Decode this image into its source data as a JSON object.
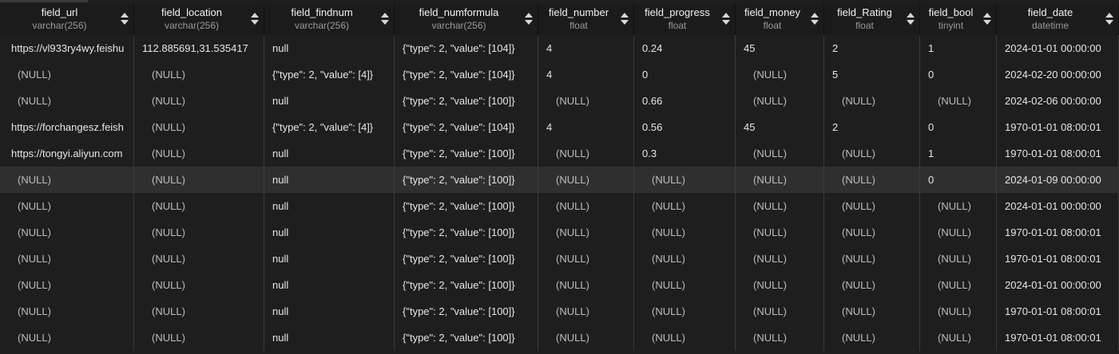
{
  "columns": [
    {
      "name": "field_url",
      "type": "varchar(256)",
      "w": 168
    },
    {
      "name": "field_location",
      "type": "varchar(256)",
      "w": 163
    },
    {
      "name": "field_findnum",
      "type": "varchar(256)",
      "w": 163
    },
    {
      "name": "field_numformula",
      "type": "varchar(256)",
      "w": 180
    },
    {
      "name": "field_number",
      "type": "float",
      "w": 120
    },
    {
      "name": "field_progress",
      "type": "float",
      "w": 127
    },
    {
      "name": "field_money",
      "type": "float",
      "w": 111
    },
    {
      "name": "field_Rating",
      "type": "float",
      "w": 120
    },
    {
      "name": "field_bool",
      "type": "tinyint",
      "w": 96
    },
    {
      "name": "field_date",
      "type": "datetime",
      "w": 153
    }
  ],
  "selected_row": 5,
  "rows": [
    [
      "https://vl933ry4wy.feishu",
      "112.885691,31.535417",
      "null",
      "{\"type\": 2, \"value\": [104]}",
      "4",
      "0.24",
      "45",
      "2",
      "1",
      "2024-01-01 00:00:00"
    ],
    [
      "(NULL)",
      "(NULL)",
      "{\"type\": 2, \"value\": [4]}",
      "{\"type\": 2, \"value\": [104]}",
      "4",
      "0",
      "(NULL)",
      "5",
      "0",
      "2024-02-20 00:00:00"
    ],
    [
      "(NULL)",
      "(NULL)",
      "null",
      "{\"type\": 2, \"value\": [100]}",
      "(NULL)",
      "0.66",
      "(NULL)",
      "(NULL)",
      "(NULL)",
      "2024-02-06 00:00:00"
    ],
    [
      "https://forchangesz.feish",
      "(NULL)",
      "{\"type\": 2, \"value\": [4]}",
      "{\"type\": 2, \"value\": [104]}",
      "4",
      "0.56",
      "45",
      "2",
      "0",
      "1970-01-01 08:00:01"
    ],
    [
      "https://tongyi.aliyun.com",
      "(NULL)",
      "null",
      "{\"type\": 2, \"value\": [100]}",
      "(NULL)",
      "0.3",
      "(NULL)",
      "(NULL)",
      "1",
      "1970-01-01 08:00:01"
    ],
    [
      "(NULL)",
      "(NULL)",
      "null",
      "{\"type\": 2, \"value\": [100]}",
      "(NULL)",
      "(NULL)",
      "(NULL)",
      "(NULL)",
      "0",
      "2024-01-09 00:00:00"
    ],
    [
      "(NULL)",
      "(NULL)",
      "null",
      "{\"type\": 2, \"value\": [100]}",
      "(NULL)",
      "(NULL)",
      "(NULL)",
      "(NULL)",
      "(NULL)",
      "2024-01-01 00:00:00"
    ],
    [
      "(NULL)",
      "(NULL)",
      "null",
      "{\"type\": 2, \"value\": [100]}",
      "(NULL)",
      "(NULL)",
      "(NULL)",
      "(NULL)",
      "(NULL)",
      "1970-01-01 08:00:01"
    ],
    [
      "(NULL)",
      "(NULL)",
      "null",
      "{\"type\": 2, \"value\": [100]}",
      "(NULL)",
      "(NULL)",
      "(NULL)",
      "(NULL)",
      "(NULL)",
      "1970-01-01 08:00:01"
    ],
    [
      "(NULL)",
      "(NULL)",
      "null",
      "{\"type\": 2, \"value\": [100]}",
      "(NULL)",
      "(NULL)",
      "(NULL)",
      "(NULL)",
      "(NULL)",
      "2024-01-01 00:00:00"
    ],
    [
      "(NULL)",
      "(NULL)",
      "null",
      "{\"type\": 2, \"value\": [100]}",
      "(NULL)",
      "(NULL)",
      "(NULL)",
      "(NULL)",
      "(NULL)",
      "1970-01-01 08:00:01"
    ],
    [
      "(NULL)",
      "(NULL)",
      "null",
      "{\"type\": 2, \"value\": [100]}",
      "(NULL)",
      "(NULL)",
      "(NULL)",
      "(NULL)",
      "(NULL)",
      "1970-01-01 08:00:01"
    ]
  ]
}
